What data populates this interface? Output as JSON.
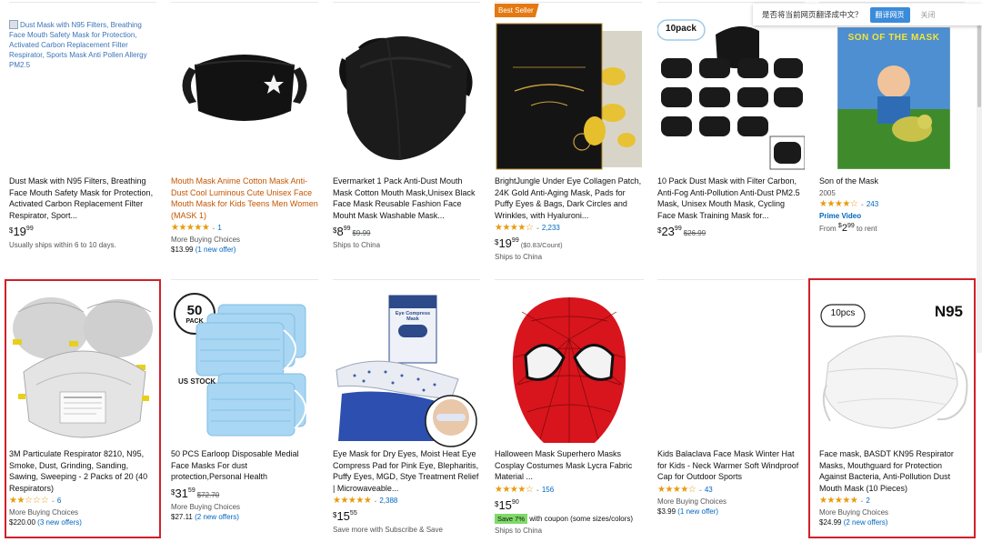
{
  "translate_bar": {
    "prompt": "是否将当前网页翻译成中文？",
    "translate_label": "翻译网页",
    "close_label": "关闭"
  },
  "row1": [
    {
      "img_alt": "Dust Mask with N95 Filters, Breathing Face Mouth Safety Mask for Protection, Activated Carbon Replacement Filter Respirator, Sports Mask Anti Pollen Allergy PM2.5",
      "title": "Dust Mask with N95 Filters, Breathing Face Mouth Safety Mask for Protection, Activated Carbon Replacement Filter Respirator, Sport...",
      "price_whole": "19",
      "price_frac": "99",
      "ship": "Usually ships within 6 to 10 days."
    },
    {
      "title": "Mouth Mask Anime Cotton Mask Anti-Dust Cool Luminous Cute Unisex Face Mouth Mask for Kids Teens Men Women (MASK 1)",
      "rating_count": "1",
      "more": "More Buying Choices",
      "offer_price": "$13.99",
      "offer_link": "(1 new offer)"
    },
    {
      "title": "Evermarket 1 Pack Anti-Dust Mouth Mask Cotton Mouth Mask,Unisex Black Face Mask Reusable Fashion Face Mouht Mask Washable Mask...",
      "price_whole": "8",
      "price_frac": "99",
      "strike": "$9.99",
      "ship": "Ships to China"
    },
    {
      "badge": "Best Seller",
      "title": "BrightJungle Under Eye Collagen Patch, 24K Gold Anti-Aging Mask, Pads for Puffy Eyes & Bags, Dark Circles and Wrinkles, with Hyaluroni...",
      "rating_count": "2,233",
      "price_whole": "19",
      "price_frac": "99",
      "unit": "($0.83/Count)",
      "ship": "Ships to China"
    },
    {
      "pack_label": "10pack",
      "title": "10 Pack Dust Mask with Filter Carbon, Anti-Fog Anti-Pollution Anti-Dust PM2.5 Mask, Unisex Mouth Mask, Cycling Face Mask Training Mask for...",
      "price_whole": "23",
      "price_frac": "99",
      "strike": "$26.99"
    },
    {
      "poster_title": "SON OF THE MASK",
      "title": "Son of the Mask",
      "year": "2005",
      "rating_count": "243",
      "prime": "Prime Video",
      "rent_prefix": "From",
      "rent_whole": "2",
      "rent_frac": "99",
      "rent_suffix": "to rent"
    }
  ],
  "row2": [
    {
      "title": "3M Particulate Respirator 8210, N95, Smoke, Dust, Grinding, Sanding, Sawing, Sweeping - 2 Packs of 20 (40 Respirators)",
      "rating_count": "6",
      "more": "More Buying Choices",
      "offer_price": "$220.00",
      "offer_link": "(3 new offers)"
    },
    {
      "pack_num": "50",
      "pack_word": "PACK",
      "stock": "US STOCK",
      "title": "50 PCS Earloop Disposable Medial Face Masks For dust protection,Personal Health",
      "price_whole": "31",
      "price_frac": "59",
      "strike": "$72.70",
      "more": "More Buying Choices",
      "offer_price": "$27.11",
      "offer_link": "(2 new offers)"
    },
    {
      "box_label": "Eye Compress Mask",
      "title": "Eye Mask for Dry Eyes, Moist Heat Eye Compress Pad for Pink Eye, Blepharitis, Puffy Eyes, MGD, Stye Treatment Relief | Microwaveable...",
      "rating_count": "2,388",
      "price_whole": "15",
      "price_frac": "55",
      "ship": "Save more with Subscribe & Save"
    },
    {
      "title": "Halloween Mask Superhero Masks Cosplay Costumes Mask Lycra Fabric Material ...",
      "rating_count": "156",
      "price_whole": "15",
      "price_frac": "90",
      "save_badge": "Save 7%",
      "save_text": "with coupon (some sizes/colors)",
      "ship": "Ships to China"
    },
    {
      "title": "Kids Balaclava Face Mask Winter Hat for Kids - Neck Warmer Soft Windproof Cap for Outdoor Sports",
      "rating_count": "43",
      "more": "More Buying Choices",
      "offer_price": "$3.99",
      "offer_link": "(1 new offer)"
    },
    {
      "pcs_label": "10pcs",
      "n95_label": "N95",
      "title": "Face mask, BASDT KN95 Respirator Masks, Mouthguard for Protection Against Bacteria, Anti-Pollution Dust Mouth Mask (10 Pieces)",
      "rating_count": "2",
      "more": "More Buying Choices",
      "offer_price": "$24.99",
      "offer_link": "(2 new offers)"
    }
  ],
  "currency": "$"
}
